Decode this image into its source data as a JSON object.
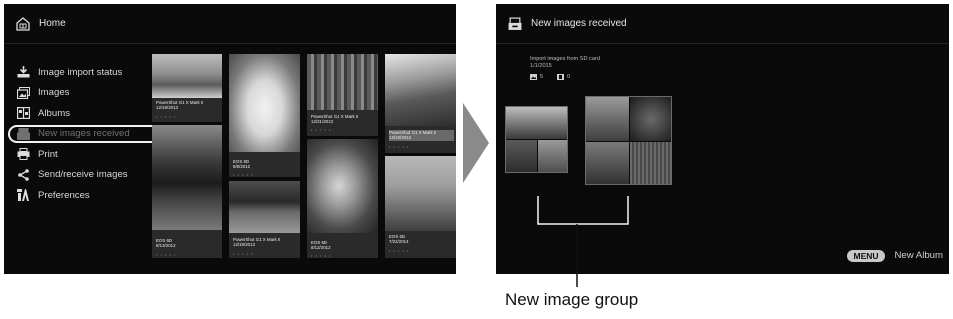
{
  "left_screen": {
    "header": {
      "title": "Home",
      "icon": "home-icon"
    },
    "menu": [
      {
        "label": "Image import status",
        "icon": "import-icon",
        "state": "normal"
      },
      {
        "label": "Images",
        "icon": "images-icon",
        "state": "normal"
      },
      {
        "label": "Albums",
        "icon": "album-icon",
        "state": "normal"
      },
      {
        "label": "New images received",
        "icon": "new-images-icon",
        "state": "selected"
      },
      {
        "label": "Print",
        "icon": "printer-icon",
        "state": "normal"
      },
      {
        "label": "Send/receive images",
        "icon": "share-icon",
        "state": "normal"
      },
      {
        "label": "Preferences",
        "icon": "preferences-icon",
        "state": "normal"
      }
    ],
    "tiles": [
      {
        "camera": "PowerShot G1 X Mark II",
        "date": "12/19/2013"
      },
      {
        "camera": "EOS 6D",
        "date": "8/13/2012"
      },
      {
        "camera": "EOS 6D",
        "date": "9/8/2012"
      },
      {
        "camera": "PowerShot G1 X Mark II",
        "date": "12/19/2013"
      },
      {
        "camera": "PowerShot G1 X Mark II",
        "date": "12/21/2013"
      },
      {
        "camera": "EOS 6D",
        "date": "8/12/2012"
      },
      {
        "camera": "PowerShot G1 X Mark II",
        "date": "12/19/2013"
      },
      {
        "camera": "EOS 6D",
        "date": "7/22/2014"
      }
    ]
  },
  "right_screen": {
    "header": {
      "title": "New images received",
      "icon": "new-images-icon"
    },
    "import": {
      "source": "Import images from SD card",
      "date": "1/1/2015",
      "photo_count": "5",
      "video_count": "0"
    },
    "menu_button": "MENU",
    "menu_action": "New Album"
  },
  "callout": "New image group",
  "colors": {
    "screen_bg": "#0a0a0a",
    "text": "#d8d8d8",
    "accent": "#f2f2f2"
  }
}
